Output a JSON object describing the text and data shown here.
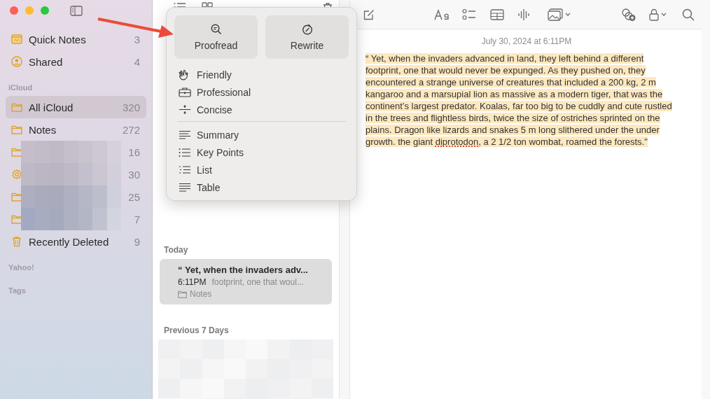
{
  "window": {
    "controls": [
      {
        "kind": "close"
      },
      {
        "kind": "minimize"
      },
      {
        "kind": "zoom"
      }
    ]
  },
  "sidebar": {
    "groups": [
      {
        "items": [
          {
            "kind": "quick-notes",
            "label": "Quick Notes",
            "count": "3",
            "selected": false
          },
          {
            "kind": "shared",
            "label": "Shared",
            "count": "4",
            "selected": false
          }
        ]
      },
      {
        "header": "iCloud",
        "items": [
          {
            "kind": "folder",
            "label": "All iCloud",
            "count": "320",
            "selected": true
          },
          {
            "kind": "folder",
            "label": "Notes",
            "count": "272",
            "selected": false
          },
          {
            "kind": "folder",
            "count": "16",
            "selected": false,
            "redacted": true
          },
          {
            "kind": "gear",
            "count": "30",
            "selected": false,
            "redacted": true
          },
          {
            "kind": "folder",
            "count": "25",
            "selected": false,
            "redacted": true
          },
          {
            "kind": "folder",
            "count": "7",
            "selected": false,
            "redacted": true
          },
          {
            "kind": "trash",
            "label": "Recently Deleted",
            "count": "9",
            "selected": false
          }
        ]
      },
      {
        "header": "Yahoo!"
      },
      {
        "header": "Tags"
      }
    ]
  },
  "note_list": {
    "sections": [
      {
        "header": "Today",
        "notes": [
          {
            "title": "“ Yet, when the invaders adv...",
            "time": "6:11PM",
            "preview": "footprint, one that woul...",
            "folder": "Notes",
            "selected": true
          }
        ]
      },
      {
        "header": "Previous 7 Days",
        "redacted": true
      }
    ]
  },
  "editor": {
    "date": "July 30, 2024 at 6:11PM",
    "body": [
      {
        "text": "“ Yet, when the invaders advanced in land, they left behind a different footprint, one that would never be expunged. As they pushed on, they encountered a strange universe of creatures that included a 200 kg, 2 m kangaroo and a marsupial lion as massive as a modern tiger, that was the continent’s largest predator. Koalas, far too big to be cuddly and cute rustled in the trees and flightless birds, twice the size of ostriches sprinted on the plains. Dragon like lizards and snakes 5 m long slithered under the under growth. the giant ",
        "misspelled": false
      },
      {
        "text": "diprotodon",
        "misspelled": true
      },
      {
        "text": ", a 2 1/2 ton wombat, roamed the forests.\"",
        "misspelled": false
      }
    ]
  },
  "writing_tools": {
    "buttons": [
      {
        "label": "Proofread"
      },
      {
        "label": "Rewrite"
      }
    ],
    "groups": [
      [
        "Friendly",
        "Professional",
        "Concise"
      ],
      [
        "Summary",
        "Key Points",
        "List",
        "Table"
      ]
    ]
  }
}
